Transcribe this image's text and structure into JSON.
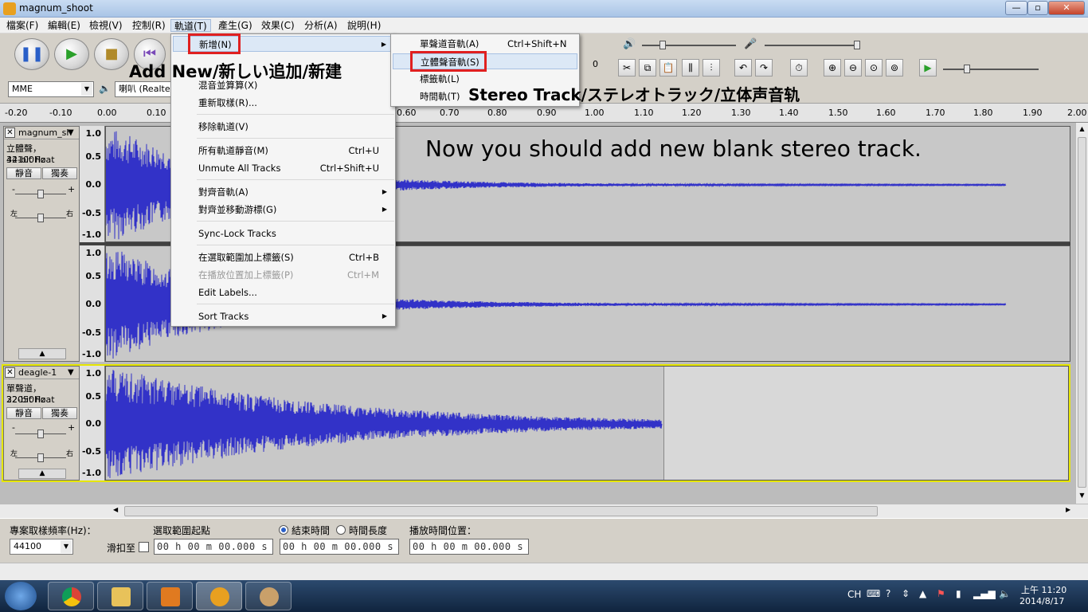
{
  "window": {
    "title": "magnum_shoot",
    "minimize": "—",
    "maximize": "▫",
    "close": "✕"
  },
  "menubar": [
    "檔案(F)",
    "編輯(E)",
    "檢視(V)",
    "控制(R)",
    "軌道(T)",
    "產生(G)",
    "效果(C)",
    "分析(A)",
    "說明(H)"
  ],
  "toolbar": {
    "pause_icon": "pause-icon",
    "play_icon": "play-icon",
    "stop_icon": "stop-icon",
    "host": "MME",
    "output_device": "喇叭 (Realte",
    "meter_value": "0"
  },
  "ruler": {
    "ticks": [
      "-0.20",
      "-0.10",
      "0.00",
      "0.10",
      "0.60",
      "0.70",
      "0.80",
      "0.90",
      "1.00",
      "1.10",
      "1.20",
      "1.30",
      "1.40",
      "1.50",
      "1.60",
      "1.70",
      "1.80",
      "1.90",
      "2.00"
    ]
  },
  "tracks": [
    {
      "name": "magnum_sh",
      "info1": "立體聲，44100Hz",
      "info2": "32-bit float",
      "mute": "靜音",
      "solo": "獨奏",
      "gain_minus": "-",
      "gain_plus": "+",
      "pan_left": "左",
      "pan_right": "右",
      "amp_labels": [
        "1.0",
        "0.5",
        "0.0",
        "-0.5",
        "-1.0"
      ]
    },
    {
      "name": "deagle-1",
      "info1": "單聲道，22050Hz",
      "info2": "32-bit float",
      "mute": "靜音",
      "solo": "獨奏",
      "gain_minus": "-",
      "gain_plus": "+",
      "pan_left": "左",
      "pan_right": "右",
      "amp_labels": [
        "1.0",
        "0.5",
        "0.0",
        "-0.5",
        "-1.0"
      ]
    }
  ],
  "tracks_menu": {
    "items": [
      {
        "label": "新增(N)",
        "shortcut": "",
        "submenu": true,
        "disabled": false
      },
      {
        "label": "混音並算算(X)",
        "shortcut": "",
        "submenu": false,
        "disabled": false
      },
      {
        "label": "重新取樣(R)...",
        "shortcut": "",
        "submenu": false,
        "disabled": false
      },
      {
        "label": "移除軌道(V)",
        "shortcut": "",
        "submenu": false,
        "disabled": false
      },
      {
        "label": "所有軌道靜音(M)",
        "shortcut": "Ctrl+U",
        "submenu": false,
        "disabled": false
      },
      {
        "label": "Unmute All Tracks",
        "shortcut": "Ctrl+Shift+U",
        "submenu": false,
        "disabled": false
      },
      {
        "label": "對齊音軌(A)",
        "shortcut": "",
        "submenu": true,
        "disabled": false
      },
      {
        "label": "對齊並移動游標(G)",
        "shortcut": "",
        "submenu": true,
        "disabled": false
      },
      {
        "label": "Sync-Lock Tracks",
        "shortcut": "",
        "submenu": false,
        "disabled": false
      },
      {
        "label": "在選取範圍加上標籤(S)",
        "shortcut": "Ctrl+B",
        "submenu": false,
        "disabled": false
      },
      {
        "label": "在播放位置加上標籤(P)",
        "shortcut": "Ctrl+M",
        "submenu": false,
        "disabled": true
      },
      {
        "label": "Edit Labels...",
        "shortcut": "",
        "submenu": false,
        "disabled": false
      },
      {
        "label": "Sort Tracks",
        "shortcut": "",
        "submenu": true,
        "disabled": false
      }
    ]
  },
  "new_submenu": {
    "items": [
      {
        "label": "單聲道音軌(A)",
        "shortcut": "Ctrl+Shift+N"
      },
      {
        "label": "立體聲音軌(S)",
        "shortcut": ""
      },
      {
        "label": "標籤軌(L)",
        "shortcut": ""
      },
      {
        "label": "時間軌(T)",
        "shortcut": ""
      }
    ]
  },
  "annotations": {
    "add_new": "Add New/新しい追加/新建",
    "stereo_track": "Stereo Track/ステレオトラック/立体声音轨",
    "instruction": "Now you should add new blank stereo track."
  },
  "selection_bar": {
    "rate_label": "專案取樣頻率(Hz)：",
    "rate_value": "44100",
    "snap_label": "滑扣至",
    "start_label": "選取範圍起點",
    "end_label": "結束時間",
    "length_label": "時間長度",
    "play_pos_label": "播放時間位置：",
    "time_value": "00 h 00 m 00.000 s"
  },
  "taskbar": {
    "lang": "CH",
    "time": "上午 11:20",
    "date": "2014/8/17"
  },
  "colors": {
    "waveform": "#3232c8",
    "highlight_box": "#e02020",
    "selected_track_border": "#e6e600"
  }
}
